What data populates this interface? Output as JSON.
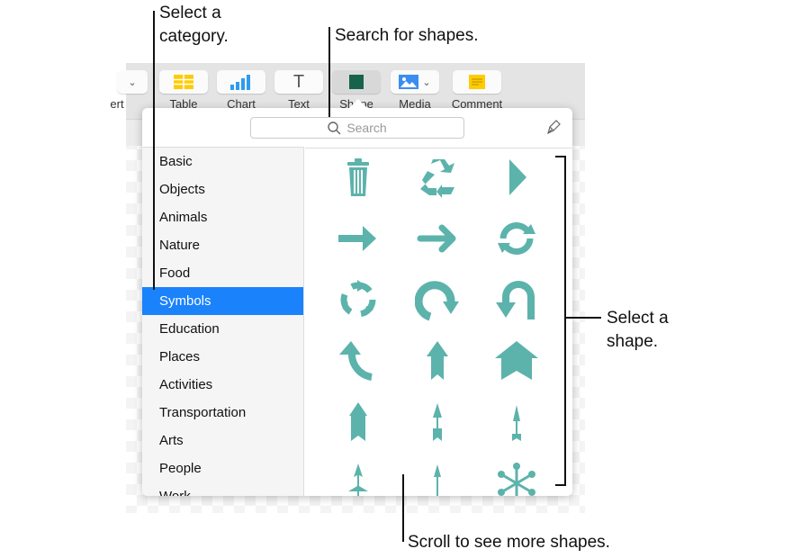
{
  "toolbar": {
    "items": [
      {
        "label": "ert"
      },
      {
        "label": "Table"
      },
      {
        "label": "Chart"
      },
      {
        "label": "Text"
      },
      {
        "label": "Shape"
      },
      {
        "label": "Media"
      },
      {
        "label": "Comment"
      }
    ]
  },
  "search": {
    "placeholder": "Search"
  },
  "categories": [
    "Basic",
    "Objects",
    "Animals",
    "Nature",
    "Food",
    "Symbols",
    "Education",
    "Places",
    "Activities",
    "Transportation",
    "Arts",
    "People",
    "Work"
  ],
  "selected_category": "Symbols",
  "shape_color": "#5cb3ab",
  "shapes": [
    "trash",
    "recycle",
    "pentagon-arrow",
    "arrow-right",
    "arrow-right-rounded",
    "refresh",
    "cycle-arrows",
    "rotate-clockwise",
    "u-turn",
    "curved-arrow-up",
    "arrow-up-notched",
    "arrow-up-chevron",
    "arrow-up-fletched",
    "arrow-thin-fletched",
    "arrow-thin",
    "arrow-up-feather",
    "arrow-thin-long",
    "snowflake-dots"
  ],
  "annotations": {
    "category": [
      "Select a",
      "category."
    ],
    "search": "Search for shapes.",
    "shape": [
      "Select a",
      "shape."
    ],
    "scroll": "Scroll to see more shapes."
  }
}
